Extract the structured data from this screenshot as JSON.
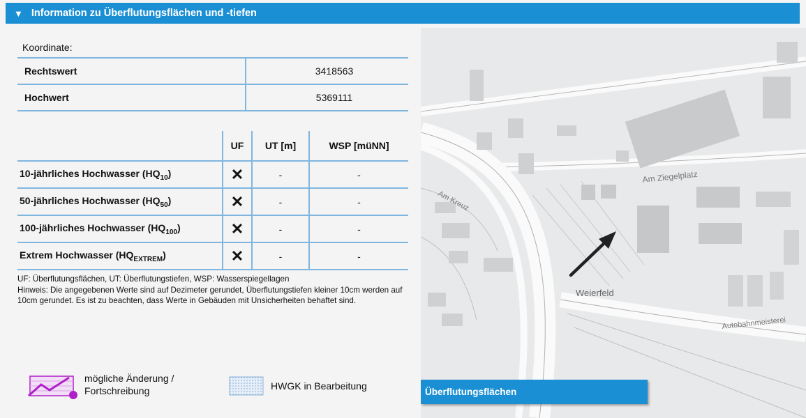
{
  "header": {
    "title": "Information zu Überflutungsflächen und -tiefen"
  },
  "coordinates": {
    "label": "Koordinate:",
    "rows": [
      {
        "key": "Rechtswert",
        "value": "3418563"
      },
      {
        "key": "Hochwert",
        "value": "5369111"
      }
    ]
  },
  "flood_table": {
    "headers": {
      "uf": "UF",
      "ut": "UT [m]",
      "wsp": "WSP [müNN]"
    },
    "rows": [
      {
        "prefix": "10-jährliches Hochwasser (HQ",
        "sub": "10",
        "suffix": ")",
        "uf": "✕",
        "ut": "-",
        "wsp": "-"
      },
      {
        "prefix": "50-jährliches Hochwasser (HQ",
        "sub": "50",
        "suffix": ")",
        "uf": "✕",
        "ut": "-",
        "wsp": "-"
      },
      {
        "prefix": "100-jährliches Hochwasser (HQ",
        "sub": "100",
        "suffix": ")",
        "uf": "✕",
        "ut": "-",
        "wsp": "-"
      },
      {
        "prefix": "Extrem Hochwasser (HQ",
        "sub": "EXTREM",
        "suffix": ")",
        "uf": "✕",
        "ut": "-",
        "wsp": "-"
      }
    ]
  },
  "notes": {
    "legend": "UF: Überflutungsflächen, UT: Überflutungstiefen, WSP: Wasserspiegellagen",
    "hint": "Hinweis: Die angegebenen Werte sind auf Dezimeter gerundet, Überflutungstiefen kleiner 10cm werden auf 10cm gerundet. Es ist zu beachten, dass Werte in Gebäuden mit Unsicherheiten behaftet sind."
  },
  "legend": {
    "change_line1": "mögliche Änderung /",
    "change_line2": "Fortschreibung",
    "hwgk": "HWGK in Bearbeitung"
  },
  "map": {
    "labels": {
      "street1": "Am Ziegelplatz",
      "street2": "Am Kreuz",
      "area": "Weierfeld",
      "road": "Autobahnmeisterei"
    },
    "tab_label": "Überflutungsflächen"
  },
  "colors": {
    "accent": "#1b8fd4",
    "table_line": "#7fb6e0",
    "change_purple": "#b01fc9"
  }
}
